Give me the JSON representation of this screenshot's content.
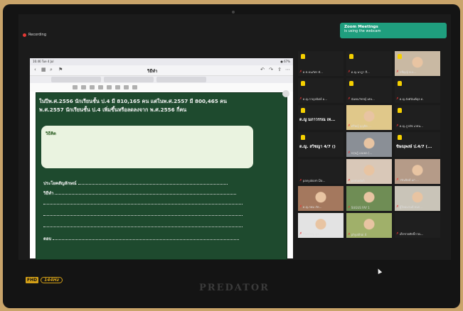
{
  "recording_label": "Recording",
  "zoom_banner": {
    "line1": "Zoom Meetings",
    "line2": "is using the webcam"
  },
  "ipad": {
    "time": "16:46  Tue 4 Jul",
    "battery": "● 67%",
    "doc_title": "วิธีทำ"
  },
  "tabs": [
    "",
    "",
    ""
  ],
  "board": {
    "question_line1": "ในปีพ.ศ.2556 นักเรียนชั้น ป.4 มี 810,165 คน แต่ในพ.ศ.2557 มี 800,465 คน",
    "question_line2": "พ.ศ.2557 นักเรียนชั้น ป.4 เพิ่มขึ้นหรือลดลงจาก พ.ศ.2556 กี่คน",
    "card_label": "วิธีคิด",
    "sentence_label": "ประโยคสัญลักษณ์",
    "method_label": "วิธีทำ",
    "answer_label": "ตอบ"
  },
  "participants": [
    {
      "name": "ด.ช.ธนภัทร ทั...",
      "hand": true
    },
    {
      "name": "ด.ญ.นาฎา สี...",
      "hand": true
    },
    {
      "name": "กชีญญ์ พ.บ...",
      "hand": true
    },
    {
      "name": "ด.ญ.กาญจนิตย์ ม...",
      "hand": true
    },
    {
      "name": "นันทนวัชรญ์ เศษ...",
      "hand": true
    },
    {
      "name": "ด.ญ.อังคันันท์ดุล ด.",
      "hand": true
    },
    {
      "name": "ด.ญ มภาวรรณ เท...",
      "hand": true,
      "big": true
    },
    {
      "name": "ศรีพญ์ บุญธิต ...",
      "hand": false
    },
    {
      "name": "ด.ญ.ภูวดัช เภทน...",
      "hand": true
    },
    {
      "name": "ด.ญ. สวิชญา 4/7 ()",
      "hand": true,
      "big": true
    },
    {
      "name": "ปรุษฎ์ เลมพล (...",
      "hand": false
    },
    {
      "name": "ขิษณุพงษ์ ป.4/7 (...",
      "hand": true,
      "big": true
    },
    {
      "name": "panyakom Da...",
      "hand": false
    },
    {
      "name": "pemadoñ",
      "hand": false
    },
    {
      "name": "วรัณจิตต์ แก่ ...",
      "hand": false
    },
    {
      "name": "ด.ญ.กพม ภัท...",
      "hand": false
    },
    {
      "name": "SUGUS FAY 1",
      "hand": false
    },
    {
      "name": "ผู้ใหม่แรนต์ ธนก...",
      "hand": false
    },
    {
      "name": "ดิษพร์อัญ ญ่อ...",
      "hand": false
    },
    {
      "name": "phyathai 4",
      "hand": false
    },
    {
      "name": "เด็กชายศักดิ์ภาณ...",
      "hand": false
    }
  ],
  "bezel": {
    "fhd": "FHD",
    "hz": "144Hz",
    "brand": "PREDATOR"
  }
}
